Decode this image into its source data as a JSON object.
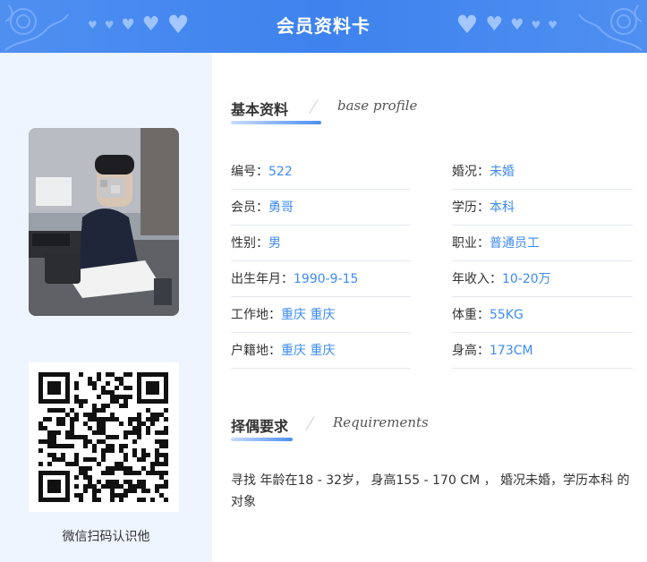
{
  "header": {
    "title": "会员资料卡"
  },
  "profile": {
    "section_title": "基本资料",
    "section_subtitle": "base profile",
    "left_fields": [
      {
        "label": "编号：",
        "value": "522"
      },
      {
        "label": "会员：",
        "value": "勇哥"
      },
      {
        "label": "性别：",
        "value": "男"
      },
      {
        "label": "出生年月：",
        "value": "1990-9-15"
      },
      {
        "label": "工作地：",
        "value": "重庆 重庆"
      },
      {
        "label": "户籍地：",
        "value": "重庆 重庆"
      }
    ],
    "right_fields": [
      {
        "label": "婚况：",
        "value": "未婚"
      },
      {
        "label": "学历：",
        "value": "本科"
      },
      {
        "label": "职业：",
        "value": "普通员工"
      },
      {
        "label": "年收入：",
        "value": "10-20万"
      },
      {
        "label": "体重：",
        "value": "55KG"
      },
      {
        "label": "身高：",
        "value": "173CM"
      }
    ]
  },
  "requirements": {
    "section_title": "择偶要求",
    "section_subtitle": "Requirements",
    "text": "寻找 年龄在18 - 32岁， 身高155 - 170 CM ， 婚况未婚，学历本科 的对象"
  },
  "sidebar": {
    "qr_caption": "微信扫码认识他"
  },
  "colors": {
    "header_blue": "#3d82ee",
    "value_blue": "#3d8bf2",
    "left_panel_bg": "#eef5fe"
  },
  "icons": [
    "heart-icon",
    "qr-code",
    "member-photo"
  ]
}
